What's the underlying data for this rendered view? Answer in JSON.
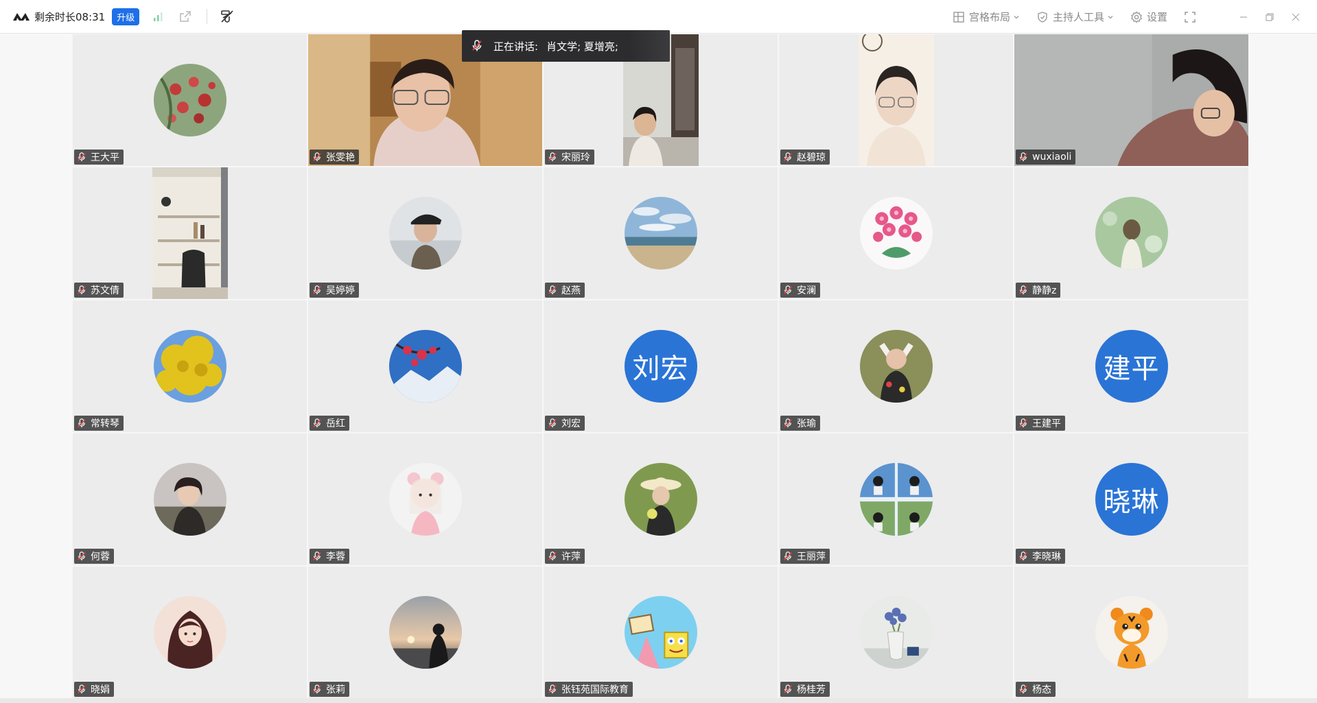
{
  "topbar": {
    "remaining_label": "剩余时长08:31",
    "upgrade_label": "升级",
    "layout_label": "宫格布局",
    "host_tools_label": "主持人工具",
    "settings_label": "设置"
  },
  "speaking": {
    "label": "正在讲话:",
    "names": "肖文学; 夏增亮;"
  },
  "tiles": [
    {
      "name": "王大平",
      "kind": "avatar",
      "avatar": "apple-tree-photo"
    },
    {
      "name": "张雯艳",
      "kind": "video",
      "avatar": "webcam-woman-glasses"
    },
    {
      "name": "宋丽玲",
      "kind": "video",
      "avatar": "webcam-woman-room"
    },
    {
      "name": "赵碧琼",
      "kind": "video",
      "avatar": "webcam-woman-glasses-light"
    },
    {
      "name": "wuxiaoli",
      "kind": "video",
      "avatar": "webcam-woman-writing"
    },
    {
      "name": "苏文倩",
      "kind": "video",
      "avatar": "office-bookshelf"
    },
    {
      "name": "吴婷婷",
      "kind": "avatar",
      "avatar": "woman-cap-portrait"
    },
    {
      "name": "赵燕",
      "kind": "avatar",
      "avatar": "beach-sky-photo"
    },
    {
      "name": "安澜",
      "kind": "avatar",
      "avatar": "pink-orchid-photo"
    },
    {
      "name": "静静z",
      "kind": "avatar",
      "avatar": "green-figure-photo"
    },
    {
      "name": "常转琴",
      "kind": "avatar",
      "avatar": "yellow-ginkgo-photo"
    },
    {
      "name": "岳红",
      "kind": "avatar",
      "avatar": "red-flower-mountain"
    },
    {
      "name": "刘宏",
      "kind": "text",
      "avatar_text": "刘宏"
    },
    {
      "name": "张瑜",
      "kind": "avatar",
      "avatar": "girl-costume-photo"
    },
    {
      "name": "王建平",
      "kind": "text",
      "avatar_text": "建平"
    },
    {
      "name": "何蓉",
      "kind": "avatar",
      "avatar": "girl-portrait-dark"
    },
    {
      "name": "李蓉",
      "kind": "avatar",
      "avatar": "cartoon-girl-bear"
    },
    {
      "name": "许萍",
      "kind": "avatar",
      "avatar": "woman-hat-green"
    },
    {
      "name": "王丽萍",
      "kind": "avatar",
      "avatar": "photo-collage"
    },
    {
      "name": "李晓琳",
      "kind": "text",
      "avatar_text": "晓琳"
    },
    {
      "name": "晓娟",
      "kind": "avatar",
      "avatar": "anime-girl-portrait"
    },
    {
      "name": "张莉",
      "kind": "avatar",
      "avatar": "sunset-silhouette"
    },
    {
      "name": "张钰苑国际教育",
      "kind": "avatar",
      "avatar": "cartoon-spongebob"
    },
    {
      "name": "杨桂芳",
      "kind": "avatar",
      "avatar": "flower-vase-photo"
    },
    {
      "name": "杨态",
      "kind": "avatar",
      "avatar": "cartoon-tiger"
    }
  ],
  "colors": {
    "accent": "#1e6fe8",
    "text_avatar_bg": "#2a74d6",
    "tile_bg": "#ececec"
  }
}
